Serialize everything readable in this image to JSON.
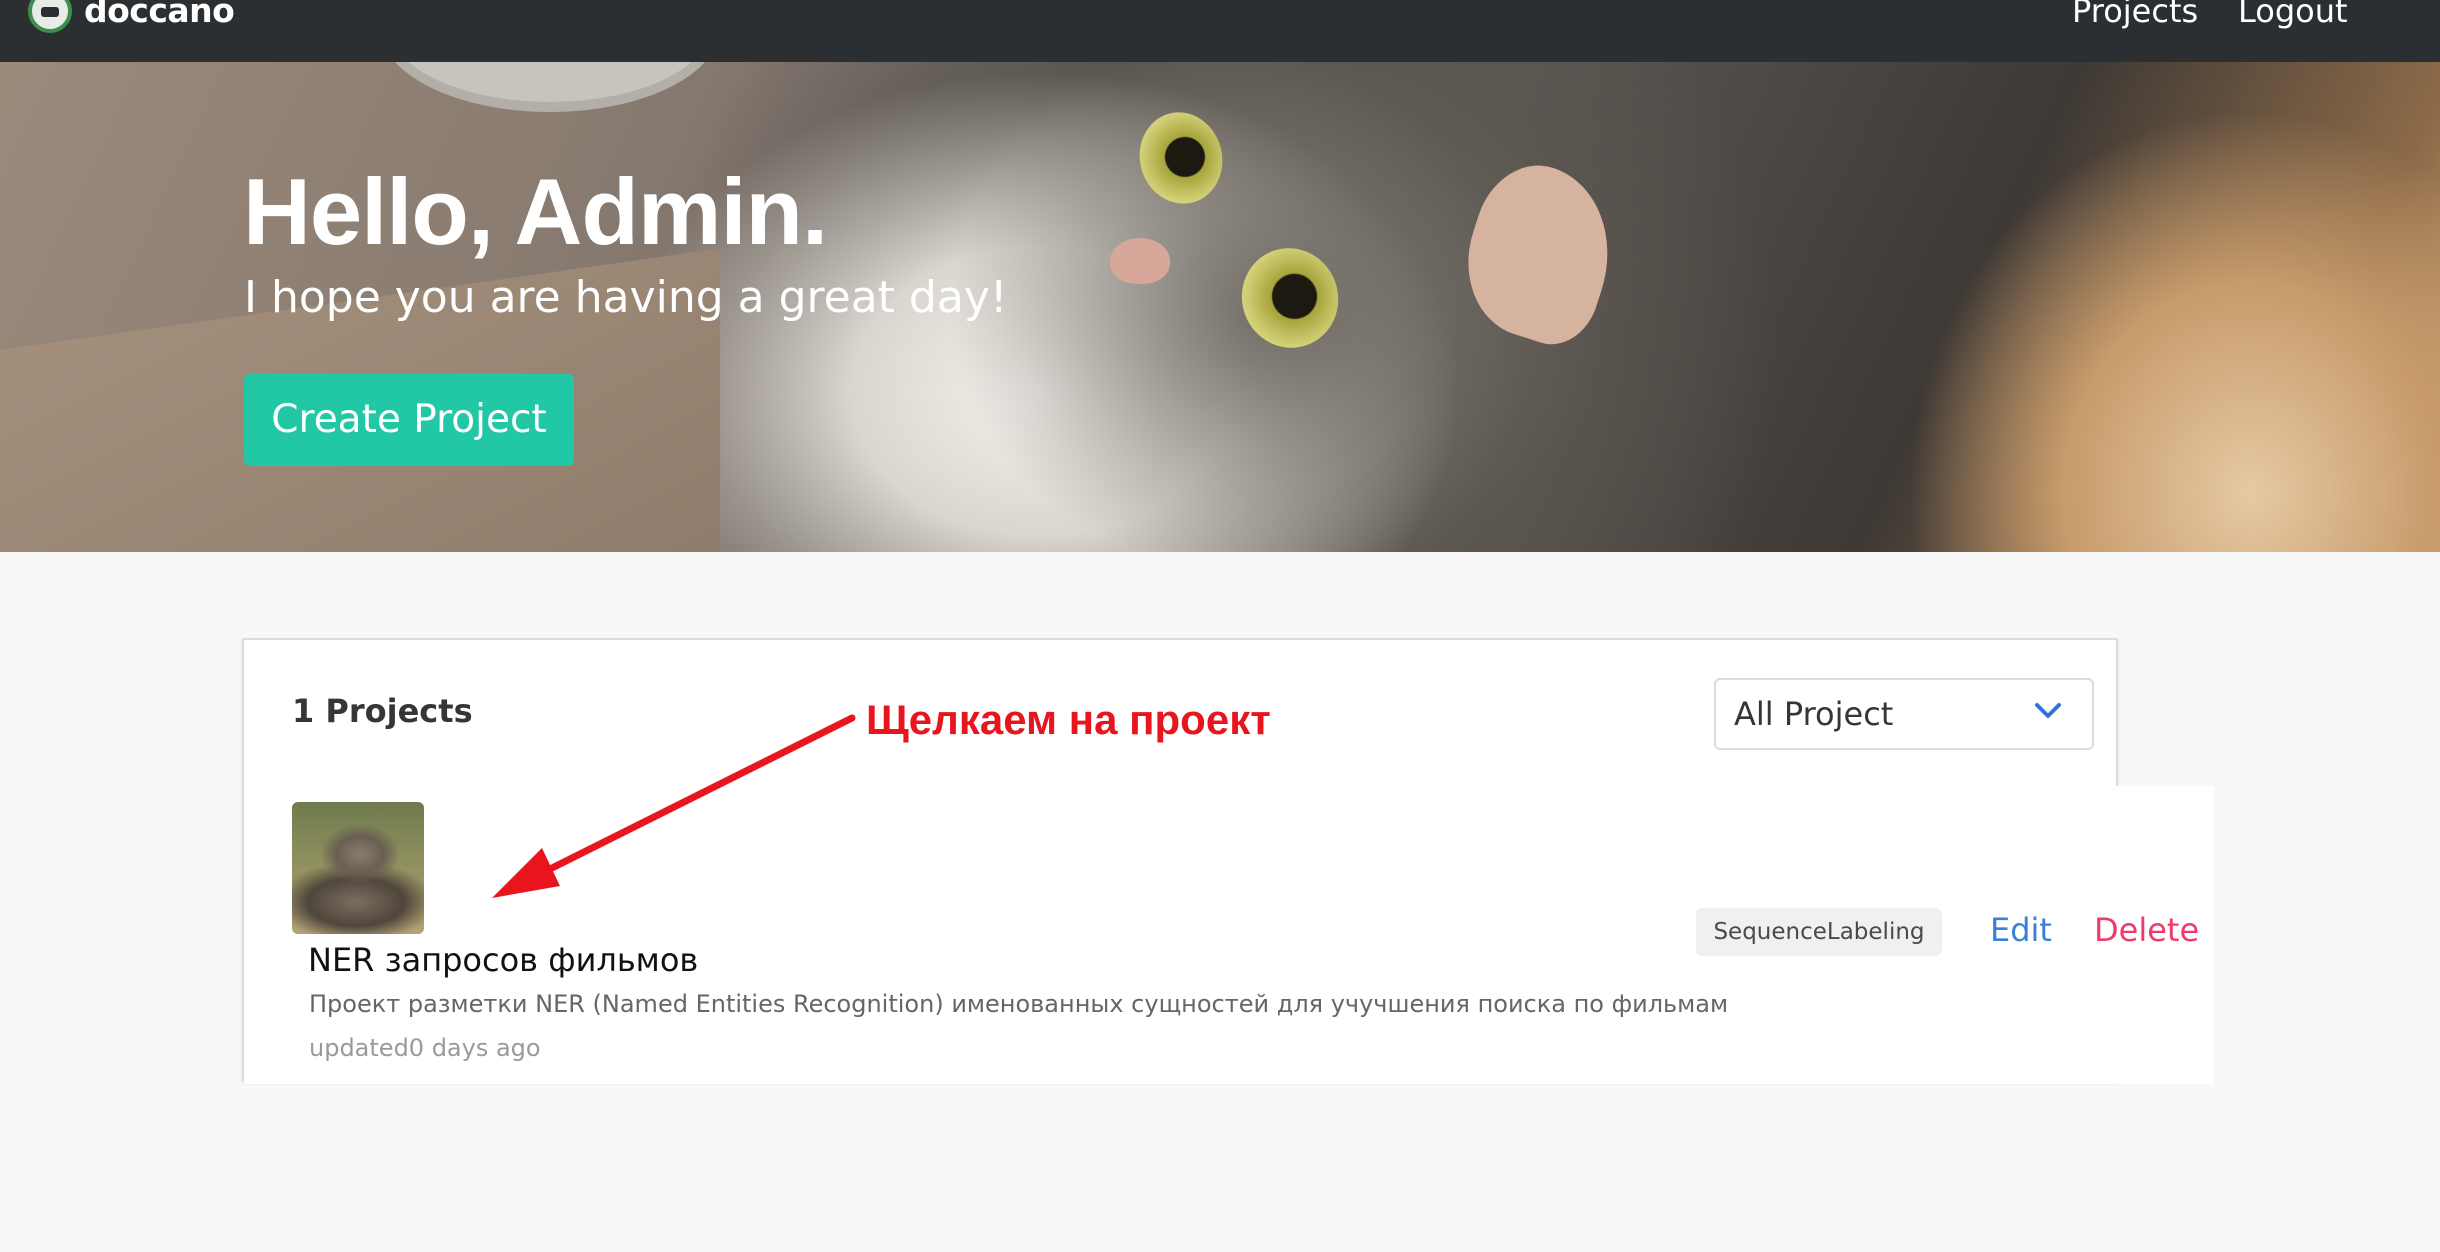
{
  "navbar": {
    "brand": "doccano",
    "links": {
      "projects": "Projects",
      "logout": "Logout"
    }
  },
  "hero": {
    "title": "Hello, Admin.",
    "subtitle": "I hope you are having a great day!",
    "create_button": "Create Project"
  },
  "projects_panel": {
    "count_label": "1 Projects",
    "filter": {
      "selected": "All Project"
    },
    "items": [
      {
        "title": "NER запросов фильмов",
        "description": "Проект разметки NER (Named Entities Recognition) именованных сущностей для учучшения поиска по фильмам",
        "updated": "updated0 days ago",
        "tag": "SequenceLabeling",
        "edit_label": "Edit",
        "delete_label": "Delete"
      }
    ]
  },
  "annotation": {
    "text": "Щелкаем на проект",
    "color": "#e8141e"
  },
  "colors": {
    "navbar": "#2b2f31",
    "accent": "#22c7a5",
    "edit": "#3b7fd9",
    "delete": "#ef3b6b"
  }
}
